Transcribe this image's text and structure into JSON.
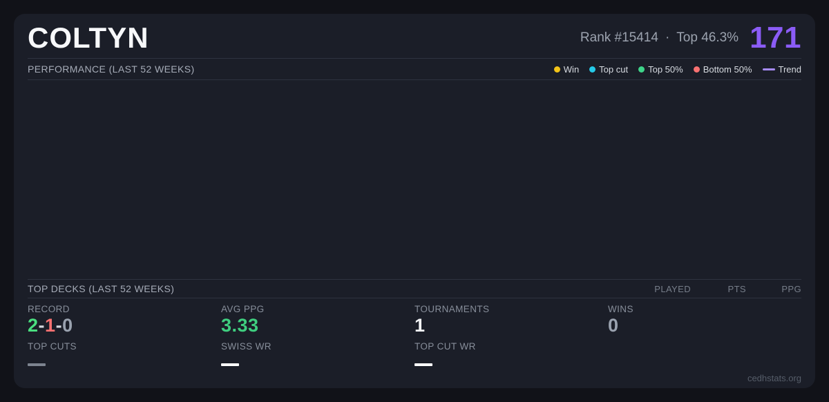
{
  "header": {
    "player_name": "COLTYN",
    "rank": "Rank #15414",
    "dot_separator": "·",
    "top_percent": "Top 46.3%",
    "points": "171",
    "points_color": "#8b5cf6"
  },
  "performance": {
    "title": "PERFORMANCE (LAST 52 WEEKS)",
    "legend": [
      {
        "label": "Win",
        "marker": "dot",
        "color": "#f2c318"
      },
      {
        "label": "Top cut",
        "marker": "dot",
        "color": "#25c9e8"
      },
      {
        "label": "Top 50%",
        "marker": "dot",
        "color": "#3ed489"
      },
      {
        "label": "Bottom 50%",
        "marker": "dot",
        "color": "#f87171"
      },
      {
        "label": "Trend",
        "marker": "line",
        "color": "#a78bfa"
      }
    ],
    "chart": {
      "type": "scatter",
      "series": [],
      "points_rendered": 0
    }
  },
  "top_decks": {
    "title": "TOP DECKS (LAST 52 WEEKS)",
    "columns": [
      "PLAYED",
      "PTS",
      "PPG"
    ],
    "rows": []
  },
  "summary": {
    "record": {
      "label": "RECORD",
      "value": "2-1-0",
      "parts": [
        {
          "text": "2",
          "color": "#4ade80"
        },
        {
          "text": "-",
          "color": "#d3d7de"
        },
        {
          "text": "1",
          "color": "#f87171"
        },
        {
          "text": "-",
          "color": "#d3d7de"
        },
        {
          "text": "0",
          "color": "#9aa2af"
        }
      ]
    },
    "avg_ppg": {
      "label": "AVG PPG",
      "value": "3.33",
      "color": "#3fce7f"
    },
    "tournaments": {
      "label": "TOURNAMENTS",
      "value": "1",
      "color": "#f3f4f6"
    },
    "wins": {
      "label": "WINS",
      "value": "0",
      "color": "#9aa2af"
    },
    "top_cuts": {
      "label": "TOP CUTS",
      "value": "—",
      "dash_color": "#7d8490"
    },
    "swiss_wr": {
      "label": "SWISS WR",
      "value": "—",
      "dash_color": "#ffffff"
    },
    "top_cut_wr": {
      "label": "TOP CUT WR",
      "value": "—",
      "dash_color": "#ffffff"
    }
  },
  "footer": {
    "watermark": "cedhstats.org"
  }
}
